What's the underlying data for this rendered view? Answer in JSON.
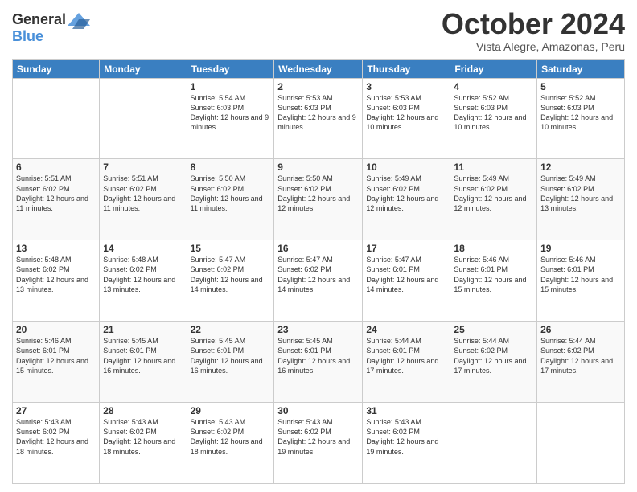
{
  "logo": {
    "line1": "General",
    "line2": "Blue"
  },
  "header": {
    "month": "October 2024",
    "location": "Vista Alegre, Amazonas, Peru"
  },
  "weekdays": [
    "Sunday",
    "Monday",
    "Tuesday",
    "Wednesday",
    "Thursday",
    "Friday",
    "Saturday"
  ],
  "weeks": [
    [
      {
        "day": "",
        "info": ""
      },
      {
        "day": "",
        "info": ""
      },
      {
        "day": "1",
        "info": "Sunrise: 5:54 AM\nSunset: 6:03 PM\nDaylight: 12 hours and 9 minutes."
      },
      {
        "day": "2",
        "info": "Sunrise: 5:53 AM\nSunset: 6:03 PM\nDaylight: 12 hours and 9 minutes."
      },
      {
        "day": "3",
        "info": "Sunrise: 5:53 AM\nSunset: 6:03 PM\nDaylight: 12 hours and 10 minutes."
      },
      {
        "day": "4",
        "info": "Sunrise: 5:52 AM\nSunset: 6:03 PM\nDaylight: 12 hours and 10 minutes."
      },
      {
        "day": "5",
        "info": "Sunrise: 5:52 AM\nSunset: 6:03 PM\nDaylight: 12 hours and 10 minutes."
      }
    ],
    [
      {
        "day": "6",
        "info": "Sunrise: 5:51 AM\nSunset: 6:02 PM\nDaylight: 12 hours and 11 minutes."
      },
      {
        "day": "7",
        "info": "Sunrise: 5:51 AM\nSunset: 6:02 PM\nDaylight: 12 hours and 11 minutes."
      },
      {
        "day": "8",
        "info": "Sunrise: 5:50 AM\nSunset: 6:02 PM\nDaylight: 12 hours and 11 minutes."
      },
      {
        "day": "9",
        "info": "Sunrise: 5:50 AM\nSunset: 6:02 PM\nDaylight: 12 hours and 12 minutes."
      },
      {
        "day": "10",
        "info": "Sunrise: 5:49 AM\nSunset: 6:02 PM\nDaylight: 12 hours and 12 minutes."
      },
      {
        "day": "11",
        "info": "Sunrise: 5:49 AM\nSunset: 6:02 PM\nDaylight: 12 hours and 12 minutes."
      },
      {
        "day": "12",
        "info": "Sunrise: 5:49 AM\nSunset: 6:02 PM\nDaylight: 12 hours and 13 minutes."
      }
    ],
    [
      {
        "day": "13",
        "info": "Sunrise: 5:48 AM\nSunset: 6:02 PM\nDaylight: 12 hours and 13 minutes."
      },
      {
        "day": "14",
        "info": "Sunrise: 5:48 AM\nSunset: 6:02 PM\nDaylight: 12 hours and 13 minutes."
      },
      {
        "day": "15",
        "info": "Sunrise: 5:47 AM\nSunset: 6:02 PM\nDaylight: 12 hours and 14 minutes."
      },
      {
        "day": "16",
        "info": "Sunrise: 5:47 AM\nSunset: 6:02 PM\nDaylight: 12 hours and 14 minutes."
      },
      {
        "day": "17",
        "info": "Sunrise: 5:47 AM\nSunset: 6:01 PM\nDaylight: 12 hours and 14 minutes."
      },
      {
        "day": "18",
        "info": "Sunrise: 5:46 AM\nSunset: 6:01 PM\nDaylight: 12 hours and 15 minutes."
      },
      {
        "day": "19",
        "info": "Sunrise: 5:46 AM\nSunset: 6:01 PM\nDaylight: 12 hours and 15 minutes."
      }
    ],
    [
      {
        "day": "20",
        "info": "Sunrise: 5:46 AM\nSunset: 6:01 PM\nDaylight: 12 hours and 15 minutes."
      },
      {
        "day": "21",
        "info": "Sunrise: 5:45 AM\nSunset: 6:01 PM\nDaylight: 12 hours and 16 minutes."
      },
      {
        "day": "22",
        "info": "Sunrise: 5:45 AM\nSunset: 6:01 PM\nDaylight: 12 hours and 16 minutes."
      },
      {
        "day": "23",
        "info": "Sunrise: 5:45 AM\nSunset: 6:01 PM\nDaylight: 12 hours and 16 minutes."
      },
      {
        "day": "24",
        "info": "Sunrise: 5:44 AM\nSunset: 6:01 PM\nDaylight: 12 hours and 17 minutes."
      },
      {
        "day": "25",
        "info": "Sunrise: 5:44 AM\nSunset: 6:02 PM\nDaylight: 12 hours and 17 minutes."
      },
      {
        "day": "26",
        "info": "Sunrise: 5:44 AM\nSunset: 6:02 PM\nDaylight: 12 hours and 17 minutes."
      }
    ],
    [
      {
        "day": "27",
        "info": "Sunrise: 5:43 AM\nSunset: 6:02 PM\nDaylight: 12 hours and 18 minutes."
      },
      {
        "day": "28",
        "info": "Sunrise: 5:43 AM\nSunset: 6:02 PM\nDaylight: 12 hours and 18 minutes."
      },
      {
        "day": "29",
        "info": "Sunrise: 5:43 AM\nSunset: 6:02 PM\nDaylight: 12 hours and 18 minutes."
      },
      {
        "day": "30",
        "info": "Sunrise: 5:43 AM\nSunset: 6:02 PM\nDaylight: 12 hours and 19 minutes."
      },
      {
        "day": "31",
        "info": "Sunrise: 5:43 AM\nSunset: 6:02 PM\nDaylight: 12 hours and 19 minutes."
      },
      {
        "day": "",
        "info": ""
      },
      {
        "day": "",
        "info": ""
      }
    ]
  ]
}
